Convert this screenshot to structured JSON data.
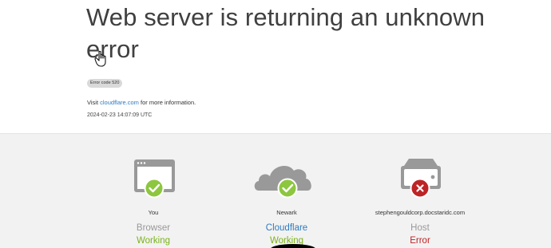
{
  "header": {
    "title": "Web server is returning an unknown error",
    "error_badge": "Error code 520",
    "visit_prefix": "Visit",
    "visit_link": "cloudflare.com",
    "visit_suffix": "for more information.",
    "timestamp": "2024-02-23 14:07:09 UTC"
  },
  "nodes": [
    {
      "icon": "browser-icon",
      "location": "You",
      "name": "Browser",
      "status": "Working",
      "status_color": "#7bb31a",
      "badge_color": "#8dc63f"
    },
    {
      "icon": "cloud-icon",
      "location": "Newark",
      "name": "Cloudflare",
      "status": "Working",
      "status_color": "#7bb31a",
      "badge_color": "#8dc63f"
    },
    {
      "icon": "server-icon",
      "location": "stephengouldcorp.docstaridc.com",
      "name": "Host",
      "status": "Error",
      "status_color": "#bd2426",
      "badge_color": "#bd2426"
    }
  ]
}
